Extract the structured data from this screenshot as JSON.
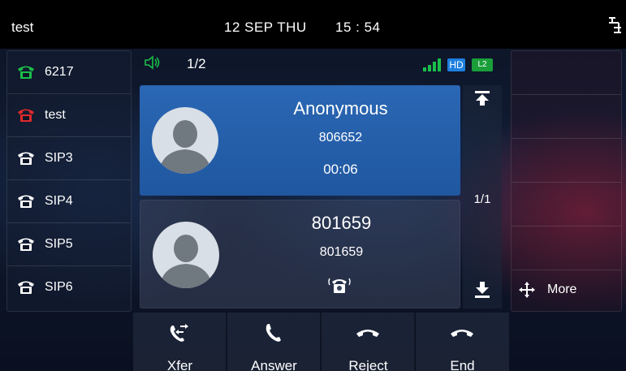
{
  "status_bar": {
    "title": "test",
    "date": "12 SEP THU",
    "time": "15 : 54",
    "network_icon": "network-icon"
  },
  "lines": [
    {
      "label": "6217",
      "icon": "phone-registered-icon",
      "color": "#1bbf4a"
    },
    {
      "label": "test",
      "icon": "phone-failed-icon",
      "color": "#e02a2a"
    },
    {
      "label": "SIP3",
      "icon": "phone-icon",
      "color": "#ffffff"
    },
    {
      "label": "SIP4",
      "icon": "phone-icon",
      "color": "#ffffff"
    },
    {
      "label": "SIP5",
      "icon": "phone-icon",
      "color": "#ffffff"
    },
    {
      "label": "SIP6",
      "icon": "phone-icon",
      "color": "#ffffff"
    }
  ],
  "call_header": {
    "call_count": "1/2",
    "hd": "HD",
    "line": "L2"
  },
  "calls": [
    {
      "name": "Anonymous",
      "number": "806652",
      "duration": "00:06",
      "state": "active"
    },
    {
      "name": "801659",
      "number": "801659",
      "state": "incoming"
    }
  ],
  "scroll": {
    "page": "1/1"
  },
  "right_panel": {
    "more_label": "More"
  },
  "softkeys": [
    {
      "label": "Xfer",
      "icon": "transfer-icon"
    },
    {
      "label": "Answer",
      "icon": "answer-icon"
    },
    {
      "label": "Reject",
      "icon": "reject-icon"
    },
    {
      "label": "End",
      "icon": "end-call-icon"
    }
  ],
  "colors": {
    "accent_blue": "#2a67b4",
    "green": "#1bbf4a",
    "red": "#e02a2a",
    "hd_blue": "#1e7fe0",
    "l2_green": "#1a9e3a"
  }
}
